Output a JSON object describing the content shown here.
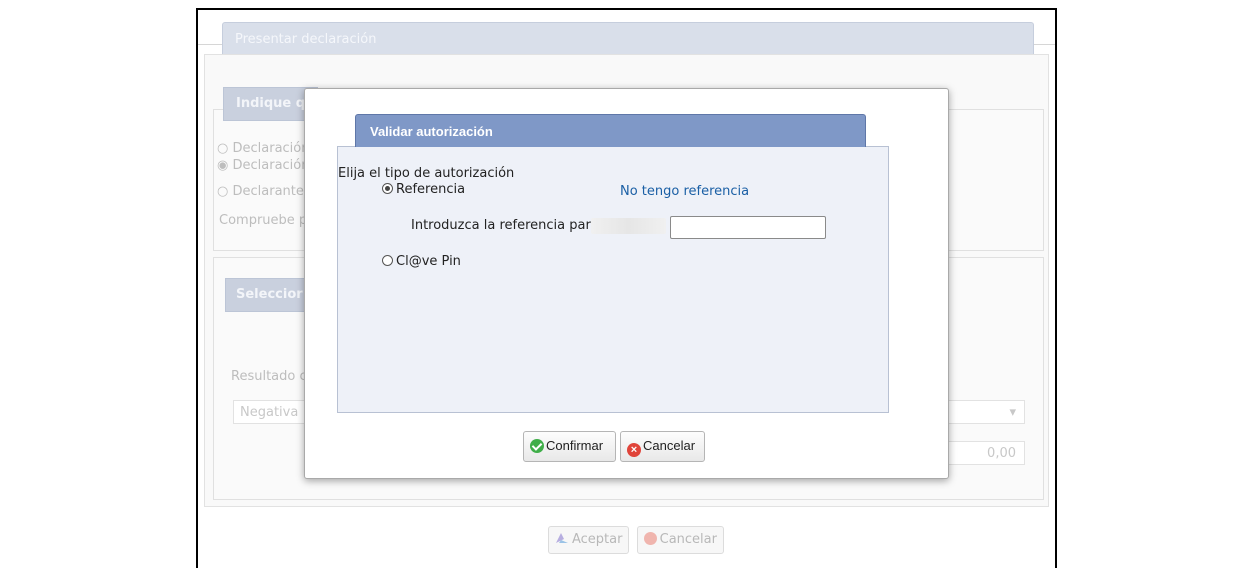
{
  "background": {
    "window_title": "Presentar declaración",
    "section1_title": "Indique q",
    "options": [
      "Declaración",
      "Declaración",
      "Declarante"
    ],
    "option_selected_index": 1,
    "check_text": "Compruebe pr",
    "section2_title": "Seleccior",
    "result_label": "Resultado c",
    "result_select_value": "Negativa",
    "amount_value": "0,00",
    "accept_button": "Aceptar",
    "cancel_button": "Cancelar"
  },
  "dialog": {
    "title": "Validar autorización",
    "prompt": "Elija el tipo de autorización",
    "option_reference": "Referencia",
    "option_reference_selected": true,
    "no_reference_link": "No tengo referencia",
    "reference_label": "Introduzca la referencia para el NIF",
    "reference_value": "",
    "option_clave_pin": "Cl@ve Pin",
    "option_clave_pin_selected": false,
    "confirm_button": "Confirmar",
    "cancel_button": "Cancelar"
  },
  "colors": {
    "dialog_title_bg": "#7f98c7",
    "link": "#1a5fa5",
    "confirm_icon": "#3fae49",
    "cancel_icon": "#e0443a"
  }
}
